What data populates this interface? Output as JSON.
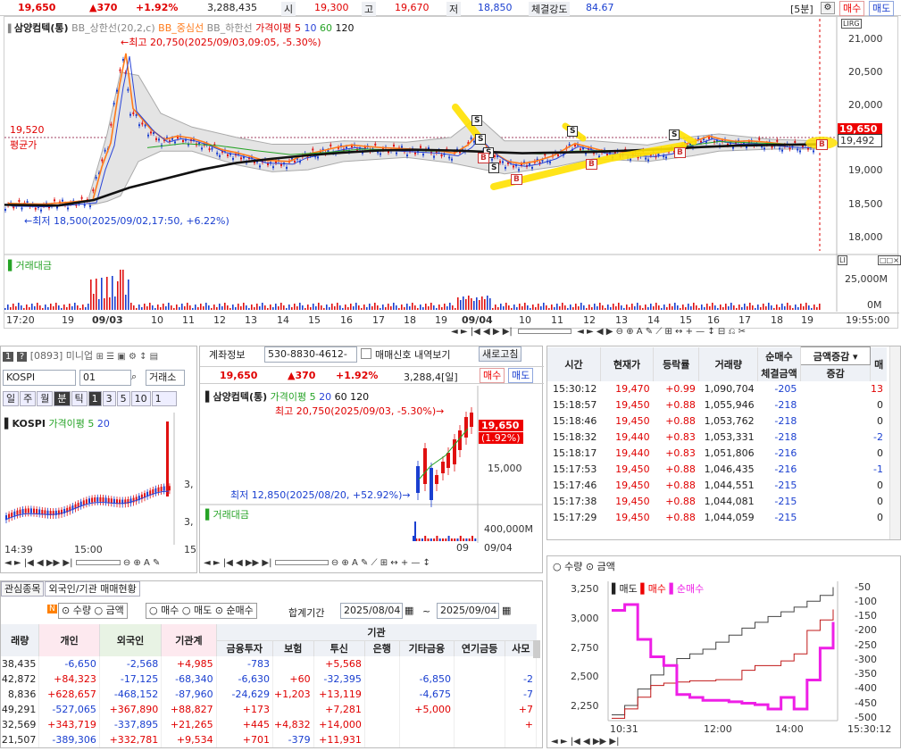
{
  "top": {
    "price": "19,650",
    "change": "▲370",
    "pct": "+1.92%",
    "volume": "3,288,435",
    "open_label": "시",
    "open": "19,300",
    "high_label": "고",
    "high": "19,670",
    "low_label": "저",
    "low": "18,850",
    "strength_label": "체결강도",
    "strength": "84.67",
    "interval": "[5분]",
    "buy_btn": "매수",
    "sell_btn": "매도"
  },
  "main_chart": {
    "legend_name": "삼양컴텍(통)",
    "legend_bb_upper": "BB_상한선(20,2,c)",
    "legend_bb_mid": "BB_중심선",
    "legend_bb_lower": "BB_하한선",
    "legend_ma": "가격이평 5",
    "legend_ma10": "10",
    "legend_ma60": "60",
    "legend_ma120": "120",
    "high_note": "최고 20,750(2025/09/03,09:05, -5.30%)",
    "low_note": "최저 18,500(2025/09/02,17:50, +6.22%)",
    "avg_price": "19,520",
    "avg_label": "평균가",
    "cur_tag": "19,650",
    "ma_tag": "19,492",
    "y_ticks": [
      "21,000",
      "20,500",
      "20,000",
      "19,500",
      "19,000",
      "18,500",
      "18,000"
    ],
    "vol_label": "거래대금",
    "vol_ticks": [
      "25,000M",
      "0M"
    ],
    "x_ticks": [
      "17:20",
      "19",
      "09/03",
      "10",
      "11",
      "12",
      "13",
      "14",
      "15",
      "16",
      "17",
      "18",
      "19",
      "09/04",
      "10",
      "11",
      "12",
      "13",
      "14",
      "15",
      "16",
      "17",
      "18",
      "19",
      "19:55:00"
    ],
    "markers_s": [
      "S",
      "S",
      "S",
      "S",
      "S",
      "S"
    ],
    "markers_b": [
      "B",
      "B",
      "B",
      "B",
      "B"
    ],
    "toolbar_icons": "◄ ► ◀ ▶ ⊖ ⊕ A ✎ ⟋ ⊞ ↔ + — ↕ ⊟ ⎌ ✂"
  },
  "mini": {
    "code": "[0893] 미니업",
    "index_input": "KOSPI",
    "field2": "01",
    "field3": "거래소",
    "tabs": [
      "일",
      "주",
      "월",
      "분",
      "틱"
    ],
    "nums": [
      "1",
      "3",
      "5",
      "10"
    ],
    "dropdown": "1",
    "legend_name": "KOSPI",
    "legend_ma": "가격이평 5",
    "legend_ma20": "20",
    "x_ticks": [
      "14:39",
      "15:00",
      "15"
    ],
    "y_ticks": [
      "3,",
      "3,",
      "3,"
    ]
  },
  "account": {
    "label": "계좌정보",
    "acct": "530-8830-4612-",
    "check_label": "매매신호 내역보기",
    "refresh": "새로고침",
    "price": "19,650",
    "change": "▲370",
    "pct": "+1.92%",
    "volume": "3,288,4[일]",
    "buy": "매수",
    "sell": "매도",
    "legend_name": "삼양컴텍(통)",
    "legend_ma": "가격이평 5",
    "l20": "20",
    "l60": "60",
    "l120": "120",
    "high_note": "최고 20,750(2025/09/03, -5.30%)",
    "low_note": "최저 12,850(2025/08/20, +52.92%)",
    "tag_price": "19,650",
    "tag_pct": "(1.92%)",
    "y_tick": "15,000",
    "vol_label": "거래대금",
    "vol_tick": "400,000M",
    "x_tick": "09",
    "x_tick2": "09/04"
  },
  "trades": {
    "headers": [
      "시간",
      "현재가",
      "등락률",
      "거래량",
      "순매수",
      "체결금액",
      "증감",
      "매"
    ],
    "amount_select": "금액증감",
    "rows": [
      [
        "15:30:12",
        "19,470",
        "+0.99",
        "1,090,704",
        "-205",
        "13"
      ],
      [
        "15:18:57",
        "19,450",
        "+0.88",
        "1,055,946",
        "-218",
        "0"
      ],
      [
        "15:18:46",
        "19,450",
        "+0.88",
        "1,053,762",
        "-218",
        "0"
      ],
      [
        "15:18:32",
        "19,440",
        "+0.83",
        "1,053,331",
        "-218",
        "-2"
      ],
      [
        "15:18:17",
        "19,440",
        "+0.83",
        "1,051,806",
        "-216",
        "0"
      ],
      [
        "15:17:53",
        "19,450",
        "+0.88",
        "1,046,435",
        "-216",
        "-1"
      ],
      [
        "15:17:46",
        "19,450",
        "+0.88",
        "1,044,551",
        "-215",
        "0"
      ],
      [
        "15:17:38",
        "19,450",
        "+0.88",
        "1,044,081",
        "-215",
        "0"
      ],
      [
        "15:17:29",
        "19,450",
        "+0.88",
        "1,044,059",
        "-215",
        "0"
      ]
    ]
  },
  "flow": {
    "radio_qty": "수량",
    "radio_amt": "금액",
    "legend_sell": "매도",
    "legend_buy": "매수",
    "legend_net": "순매수",
    "left_ticks": [
      "3,250",
      "3,000",
      "2,750",
      "2,500",
      "2,250"
    ],
    "right_ticks": [
      "-50",
      "-100",
      "-150",
      "-200",
      "-250",
      "-300",
      "-350",
      "-400",
      "-450",
      "-500"
    ],
    "x_ticks": [
      "10:31",
      "12:00",
      "14:00",
      "15:30:12"
    ]
  },
  "investor": {
    "tab1": "관심종목",
    "tab2": "외국인/기관 매매현황",
    "badge": "N",
    "r_qty": "수량",
    "r_amt": "금액",
    "r_buy": "매수",
    "r_sell": "매도",
    "r_net": "순매수",
    "period_label": "합계기간",
    "date_from": "2025/08/04",
    "tilde": "~",
    "date_to": "2025/09/04",
    "inst_header": "기관",
    "headers": [
      "래량",
      "개인",
      "외국인",
      "기관계",
      "금융투자",
      "보험",
      "투신",
      "은행",
      "기타금융",
      "연기금등",
      "사모"
    ],
    "rows": [
      [
        "38,435",
        "-6,650",
        "-2,568",
        "+4,985",
        "-783",
        "",
        "+5,568",
        "",
        "",
        "",
        ""
      ],
      [
        "42,872",
        "+84,323",
        "-17,125",
        "-68,340",
        "-6,630",
        "+60",
        "-32,395",
        "",
        "-6,850",
        "",
        "-2"
      ],
      [
        "8,836",
        "+628,657",
        "-468,152",
        "-87,960",
        "-24,629",
        "+1,203",
        "+13,119",
        "",
        "-4,675",
        "",
        "-7"
      ],
      [
        "49,291",
        "-527,065",
        "+367,890",
        "+88,827",
        "+173",
        "",
        "+7,281",
        "",
        "+5,000",
        "",
        "+7"
      ],
      [
        "32,569",
        "+343,719",
        "-337,895",
        "+21,265",
        "+445",
        "+4,832",
        "+14,000",
        "",
        "",
        "",
        "+"
      ],
      [
        "21,507",
        "-389,306",
        "+332,781",
        "+9,534",
        "+701",
        "-379",
        "+11,931",
        "",
        "",
        "",
        ""
      ]
    ]
  },
  "chart_data": [
    {
      "type": "line",
      "title": "삼양컴텍(통) 5분",
      "ylim": [
        17900,
        21300
      ],
      "y_ticks": [
        21000,
        20500,
        20000,
        19500,
        19000,
        18500,
        18000
      ],
      "high": 20750,
      "low": 18500,
      "last": 19650
    },
    {
      "type": "line",
      "series": [
        {
          "name": "매도",
          "values": [
            2180,
            2260,
            2400,
            2520,
            2600,
            2660,
            2700,
            2740,
            2800,
            2860,
            2920,
            2970,
            3020,
            3060,
            3100,
            3150,
            3200,
            3270
          ]
        },
        {
          "name": "매수",
          "values": [
            2150,
            2230,
            2330,
            2430,
            2450,
            2460,
            2470,
            2470,
            2480,
            2480,
            2560,
            2600,
            2600,
            2640,
            2700,
            2900,
            2990,
            3080
          ]
        },
        {
          "name": "순매수",
          "values": [
            -130,
            -110,
            -230,
            -290,
            -320,
            -420,
            -430,
            -440,
            -440,
            -445,
            -450,
            -455,
            -470,
            -430,
            -470,
            -370,
            -260,
            -170
          ]
        }
      ]
    }
  ]
}
